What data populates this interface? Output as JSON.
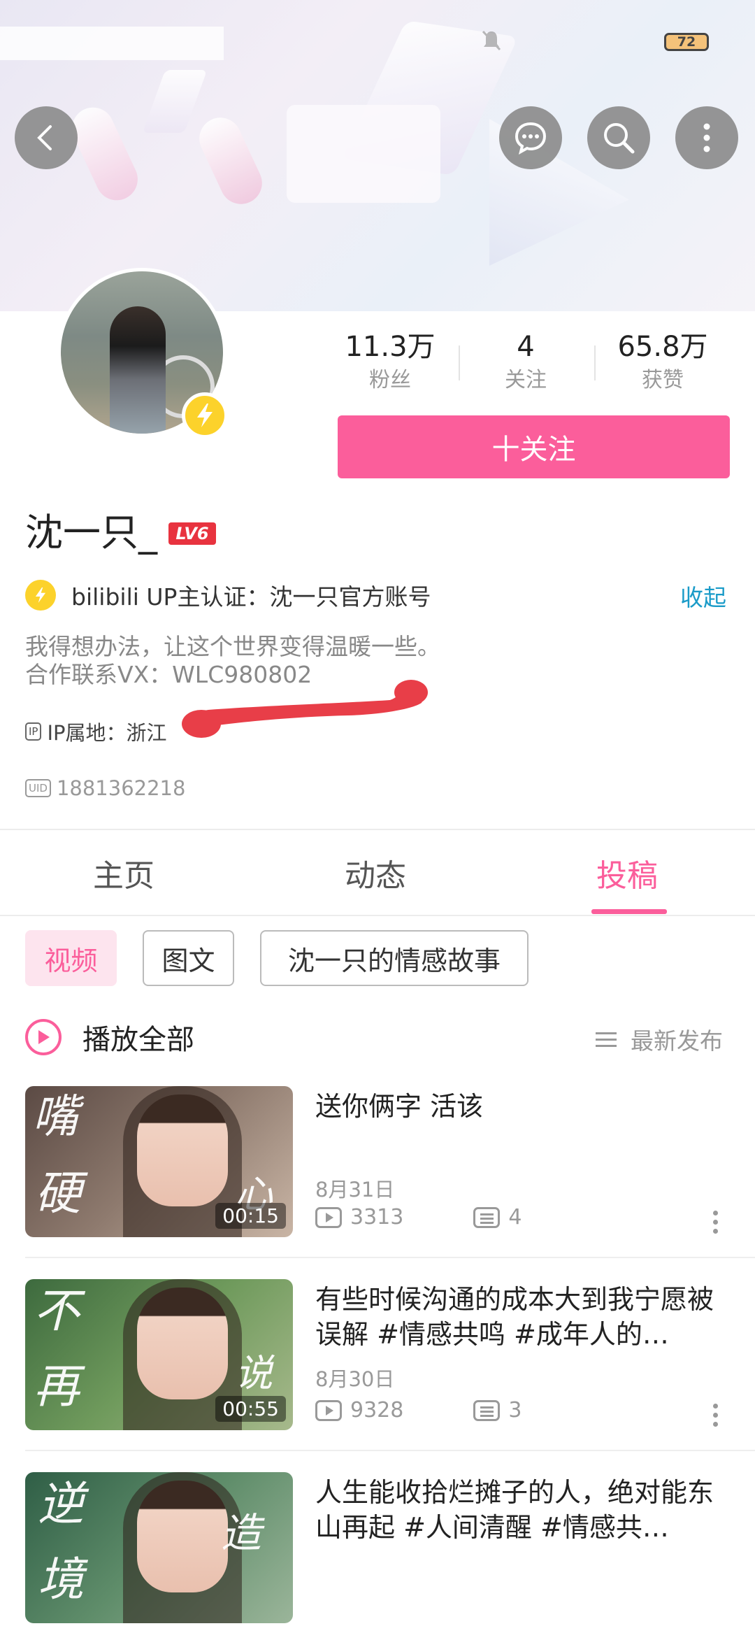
{
  "status_bar": {
    "battery": "72"
  },
  "header": {
    "back_icon": "chevron-left-icon",
    "message_icon": "chat-bubble-icon",
    "search_icon": "search-icon",
    "more_icon": "vertical-dots-icon"
  },
  "profile": {
    "stats": [
      {
        "value": "11.3万",
        "label": "粉丝"
      },
      {
        "value": "4",
        "label": "关注"
      },
      {
        "value": "65.8万",
        "label": "获赞"
      }
    ],
    "follow_label": "十关注",
    "name": "沈一只_",
    "level": "LV6",
    "verification": "bilibili UP主认证：沈一只官方账号",
    "collapse_label": "收起",
    "bio_line1": "我得想办法，让这个世界变得温暖一些。",
    "bio_line2": "合作联系VX：WLC980802",
    "ip_tag": "IP",
    "ip_text": "IP属地：浙江",
    "uid_tag": "UID",
    "uid": "1881362218"
  },
  "tabs": [
    {
      "label": "主页"
    },
    {
      "label": "动态"
    },
    {
      "label": "投稿",
      "active": true
    }
  ],
  "filter_chips": [
    {
      "label": "视频",
      "active": true
    },
    {
      "label": "图文"
    },
    {
      "label": "沈一只的情感故事"
    }
  ],
  "play_all_label": "播放全部",
  "sort_label": "最新发布",
  "videos": [
    {
      "title": "送你俩字 活该",
      "date": "8月31日",
      "views": "3313",
      "comments": "4",
      "duration": "00:15",
      "thumb_text_a": "嘴",
      "thumb_text_b": "硬",
      "thumb_text_c": "心"
    },
    {
      "title": "有些时候沟通的成本大到我宁愿被误解 #情感共鸣 #成年人的…",
      "date": "8月30日",
      "views": "9328",
      "comments": "3",
      "duration": "00:55",
      "thumb_text_a": "不",
      "thumb_text_b": "再",
      "thumb_text_c": "说"
    },
    {
      "title": "人生能收拾烂摊子的人，绝对能东山再起 #人间清醒 #情感共…",
      "date": "",
      "views": "",
      "comments": "",
      "duration": "",
      "thumb_text_a": "逆",
      "thumb_text_b": "境",
      "thumb_text_c": "造"
    }
  ],
  "colors": {
    "accent": "#fb5e9b",
    "link": "#1a9bc8",
    "badge_yellow": "#fcd22b",
    "level_red": "#e8333f"
  }
}
